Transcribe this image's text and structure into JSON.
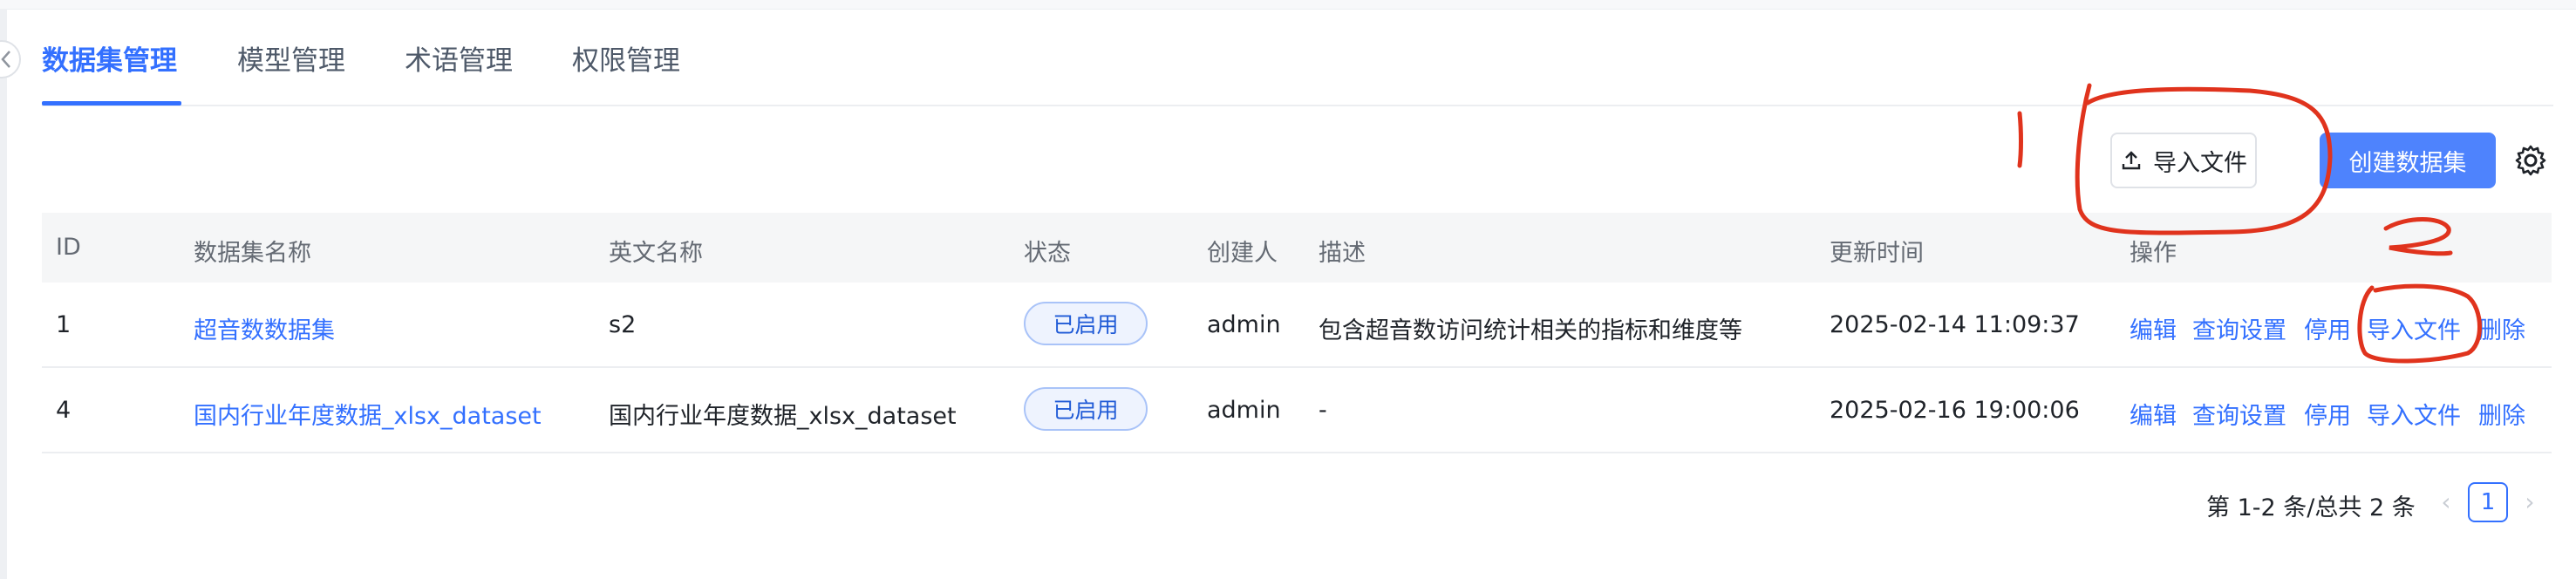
{
  "tabs": [
    {
      "label": "数据集管理",
      "active": true
    },
    {
      "label": "模型管理",
      "active": false
    },
    {
      "label": "术语管理",
      "active": false
    },
    {
      "label": "权限管理",
      "active": false
    }
  ],
  "toolbar": {
    "import_label": "导入文件",
    "create_label": "创建数据集",
    "settings_icon": "gear-icon"
  },
  "table": {
    "headers": [
      "ID",
      "数据集名称",
      "英文名称",
      "状态",
      "创建人",
      "描述",
      "更新时间",
      "操作"
    ],
    "rows": [
      {
        "id": "1",
        "name": "超音数数据集",
        "en_name": "s2",
        "status": "已启用",
        "creator": "admin",
        "desc": "包含超音数访问统计相关的指标和维度等",
        "updated": "2025-02-14 11:09:37",
        "actions": [
          "编辑",
          "查询设置",
          "停用",
          "导入文件",
          "删除"
        ]
      },
      {
        "id": "4",
        "name": "国内行业年度数据_xlsx_dataset",
        "en_name": "国内行业年度数据_xlsx_dataset",
        "status": "已启用",
        "creator": "admin",
        "desc": "-",
        "updated": "2025-02-16 19:00:06",
        "actions": [
          "编辑",
          "查询设置",
          "停用",
          "导入文件",
          "删除"
        ]
      }
    ]
  },
  "pagination": {
    "total_text": "第 1-2 条/总共 2 条",
    "current_page": "1"
  },
  "colors": {
    "accent": "#3370ff",
    "primary_button": "#4e83fd",
    "annotation": "#e0331d"
  },
  "annotations": {
    "mark_1": "1",
    "mark_2": "2"
  }
}
